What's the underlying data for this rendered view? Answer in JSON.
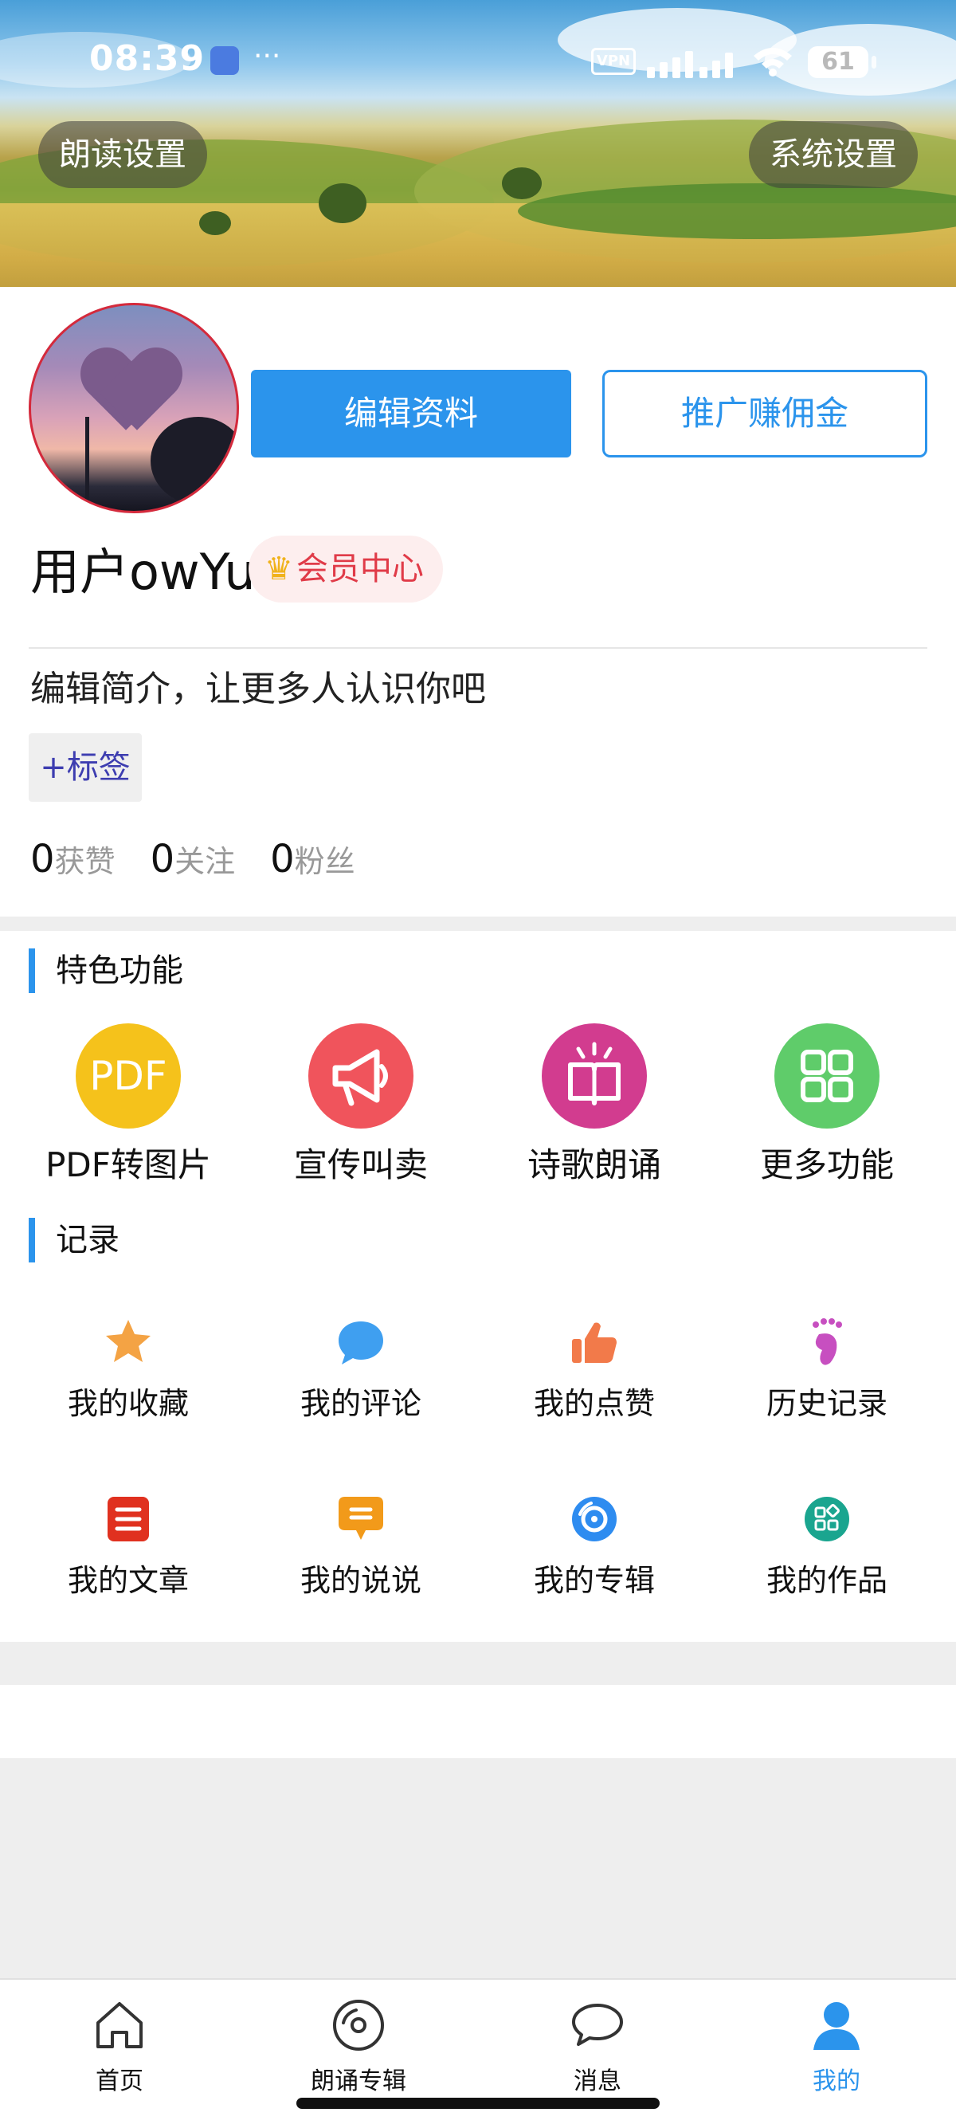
{
  "status_bar": {
    "time": "08:39",
    "vpn": "VPN",
    "battery": "61"
  },
  "header": {
    "left_button": "朗读设置",
    "right_button": "系统设置"
  },
  "profile": {
    "edit_button": "编辑资料",
    "promote_button": "推广赚佣金",
    "username": "用户owYu",
    "vip_label": "会员中心",
    "bio": "编辑简介，让更多人认识你吧",
    "tag_button": "+标签",
    "stats": [
      {
        "num": "0",
        "label": "获赞"
      },
      {
        "num": "0",
        "label": "关注"
      },
      {
        "num": "0",
        "label": "粉丝"
      }
    ]
  },
  "features": {
    "title": "特色功能",
    "items": [
      {
        "label": "PDF转图片",
        "icon": "pdf-icon",
        "icon_text": "PDF",
        "color": "#f5c21b"
      },
      {
        "label": "宣传叫卖",
        "icon": "megaphone-icon",
        "color": "#f0545c"
      },
      {
        "label": "诗歌朗诵",
        "icon": "book-icon",
        "color": "#d23c8f"
      },
      {
        "label": "更多功能",
        "icon": "grid-icon",
        "color": "#5fcc6a"
      }
    ]
  },
  "records": {
    "title": "记录",
    "items": [
      {
        "label": "我的收藏",
        "icon": "star-icon",
        "color": "#f4a344"
      },
      {
        "label": "我的评论",
        "icon": "comment-icon",
        "color": "#3f9ff0"
      },
      {
        "label": "我的点赞",
        "icon": "thumbs-up-icon",
        "color": "#f27a4a"
      },
      {
        "label": "历史记录",
        "icon": "footprint-icon",
        "color": "#c74fc0"
      },
      {
        "label": "我的文章",
        "icon": "article-icon",
        "color": "#e0311f"
      },
      {
        "label": "我的说说",
        "icon": "chat-icon",
        "color": "#f29a1a"
      },
      {
        "label": "我的专辑",
        "icon": "album-icon",
        "color": "#2e8cf0"
      },
      {
        "label": "我的作品",
        "icon": "works-icon",
        "color": "#1aa58f"
      }
    ]
  },
  "tabbar": {
    "items": [
      {
        "label": "首页",
        "icon": "home-icon"
      },
      {
        "label": "朗诵专辑",
        "icon": "disc-icon"
      },
      {
        "label": "消息",
        "icon": "message-icon"
      },
      {
        "label": "我的",
        "icon": "user-icon",
        "active": true
      }
    ]
  }
}
